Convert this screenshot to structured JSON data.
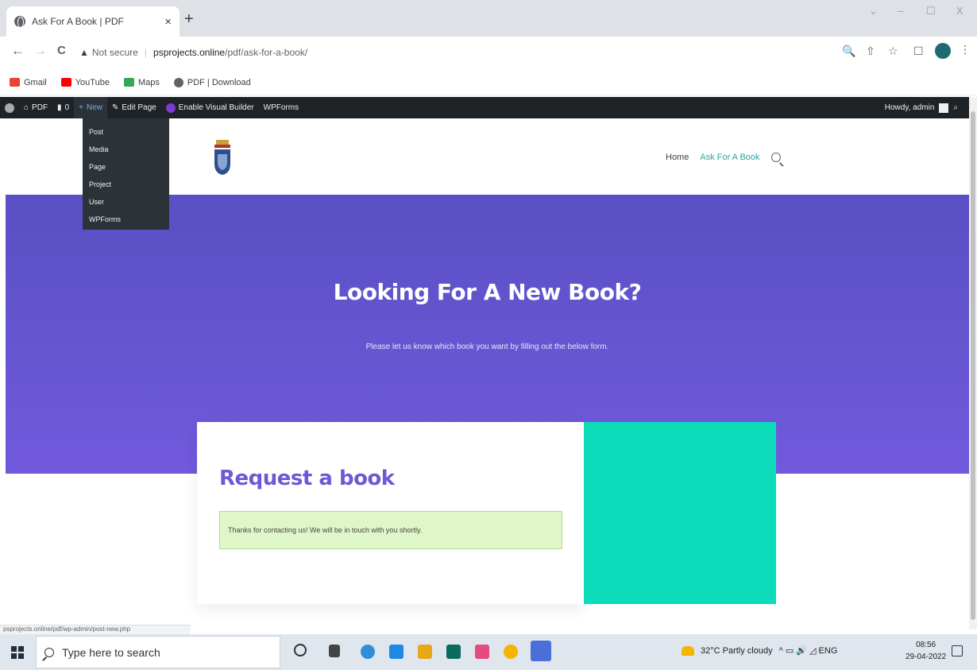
{
  "browser": {
    "tab_title": "Ask For A Book | PDF",
    "tab_close": "×",
    "new_tab": "+",
    "back": "←",
    "forward": "→",
    "reload": "C",
    "warning": "▲",
    "not_secure": "Not secure",
    "separator": "|",
    "url_host": "psprojects.online",
    "url_path": "/pdf/ask-for-a-book/",
    "minimize": "–",
    "maximize": "☐",
    "close": "X",
    "chevron": "⌄",
    "zoom": "🔍",
    "share": "⇧",
    "star": "☆",
    "sidebar": "☐",
    "menu": "⋮"
  },
  "bookmarks": [
    {
      "label": "Gmail",
      "color": "#ea4335"
    },
    {
      "label": "YouTube",
      "color": "#ff0000"
    },
    {
      "label": "Maps",
      "color": "#34a853"
    },
    {
      "label": "PDF | Download",
      "color": "#5f6368"
    }
  ],
  "adminbar": {
    "site": "PDF",
    "comments": "0",
    "new": "New",
    "edit_page": "Edit Page",
    "visual_builder": "Enable Visual Builder",
    "wpforms": "WPForms",
    "howdy": "Howdy, admin"
  },
  "new_menu": [
    "Post",
    "Media",
    "Page",
    "Project",
    "User",
    "WPForms"
  ],
  "site": {
    "nav_home": "Home",
    "nav_current": "Ask For A Book",
    "accent": "#2ea3a3"
  },
  "hero": {
    "title": "Looking For A New Book?",
    "subtitle": "Please let us know which book you want by filling out the below form."
  },
  "form": {
    "title": "Request a book",
    "success": "Thanks for contacting us! We will be in touch with you shortly."
  },
  "status_url": "psprojects.online/pdf/wp-admin/post-new.php",
  "taskbar": {
    "search_placeholder": "Type here to search",
    "weather": "32°C  Partly cloudy",
    "tray": "^  ▭  🔊  ◿  ENG",
    "time": "08:56",
    "date": "29-04-2022"
  }
}
